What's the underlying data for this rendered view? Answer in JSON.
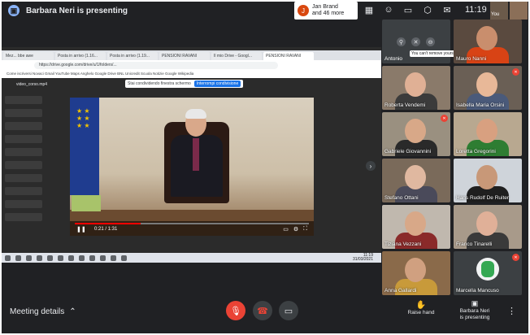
{
  "header": {
    "presenter_text": "Barbara Neri is presenting",
    "join_text_line1": "Jan Brand",
    "join_text_line2": "and 46 more",
    "join_avatar_letter": "J",
    "clock": "11:19",
    "self_label": "You"
  },
  "shared_screen": {
    "tabs": [
      "Mez... bbe awe",
      "Posta in arrivo (1.16...",
      "Posta in arrivo (1.19...",
      "PENSIONI RAVANI",
      "Il mio Drive - Googl...",
      "PENSIONI RAVANI"
    ],
    "address": "https://drive.google.com/drive/u/1/folders/...",
    "bookmarks": "Come iscriversi   Novaci   Gmail   YouTube   Maps   Anghelo   Google Drive   BNL   Unicredit   Scuola   Notizie   Google   Wikipedia",
    "share_message": "Stai condividendo finestra schermo",
    "stop_share_label": "Interrompi condivisione",
    "drive_title": "video_corso.mp4",
    "video_time": "0:21 / 1:31",
    "video_progress_pct": 28,
    "taskbar_time": "11:19",
    "taskbar_date": "31/03/2021"
  },
  "participants": {
    "self_tile": {
      "name": "Antonio",
      "hint": "You can't remove yourself"
    },
    "tiles": [
      {
        "name": "Mauro Nanni"
      },
      {
        "name": "Roberta Vendemi"
      },
      {
        "name": "Isabella Maria Orsini"
      },
      {
        "name": "Gabriele Giovannini"
      },
      {
        "name": "Loretta Gregorini"
      },
      {
        "name": "Stefano Ottani"
      },
      {
        "name": "Hans Rudolf De Ruiter"
      },
      {
        "name": "Tiziana Vezzani"
      },
      {
        "name": "Franco Tinarelli"
      },
      {
        "name": "Anna Gallardi"
      },
      {
        "name": "Marcella Mancuso"
      }
    ]
  },
  "footer": {
    "meeting_details_label": "Meeting details",
    "raise_hand_label": "Raise hand",
    "present_label_line1": "Barbara Neri",
    "present_label_line2": "is presenting"
  },
  "colors": {
    "background": "#202124",
    "danger": "#ea4335",
    "accent": "#1a73e8"
  }
}
